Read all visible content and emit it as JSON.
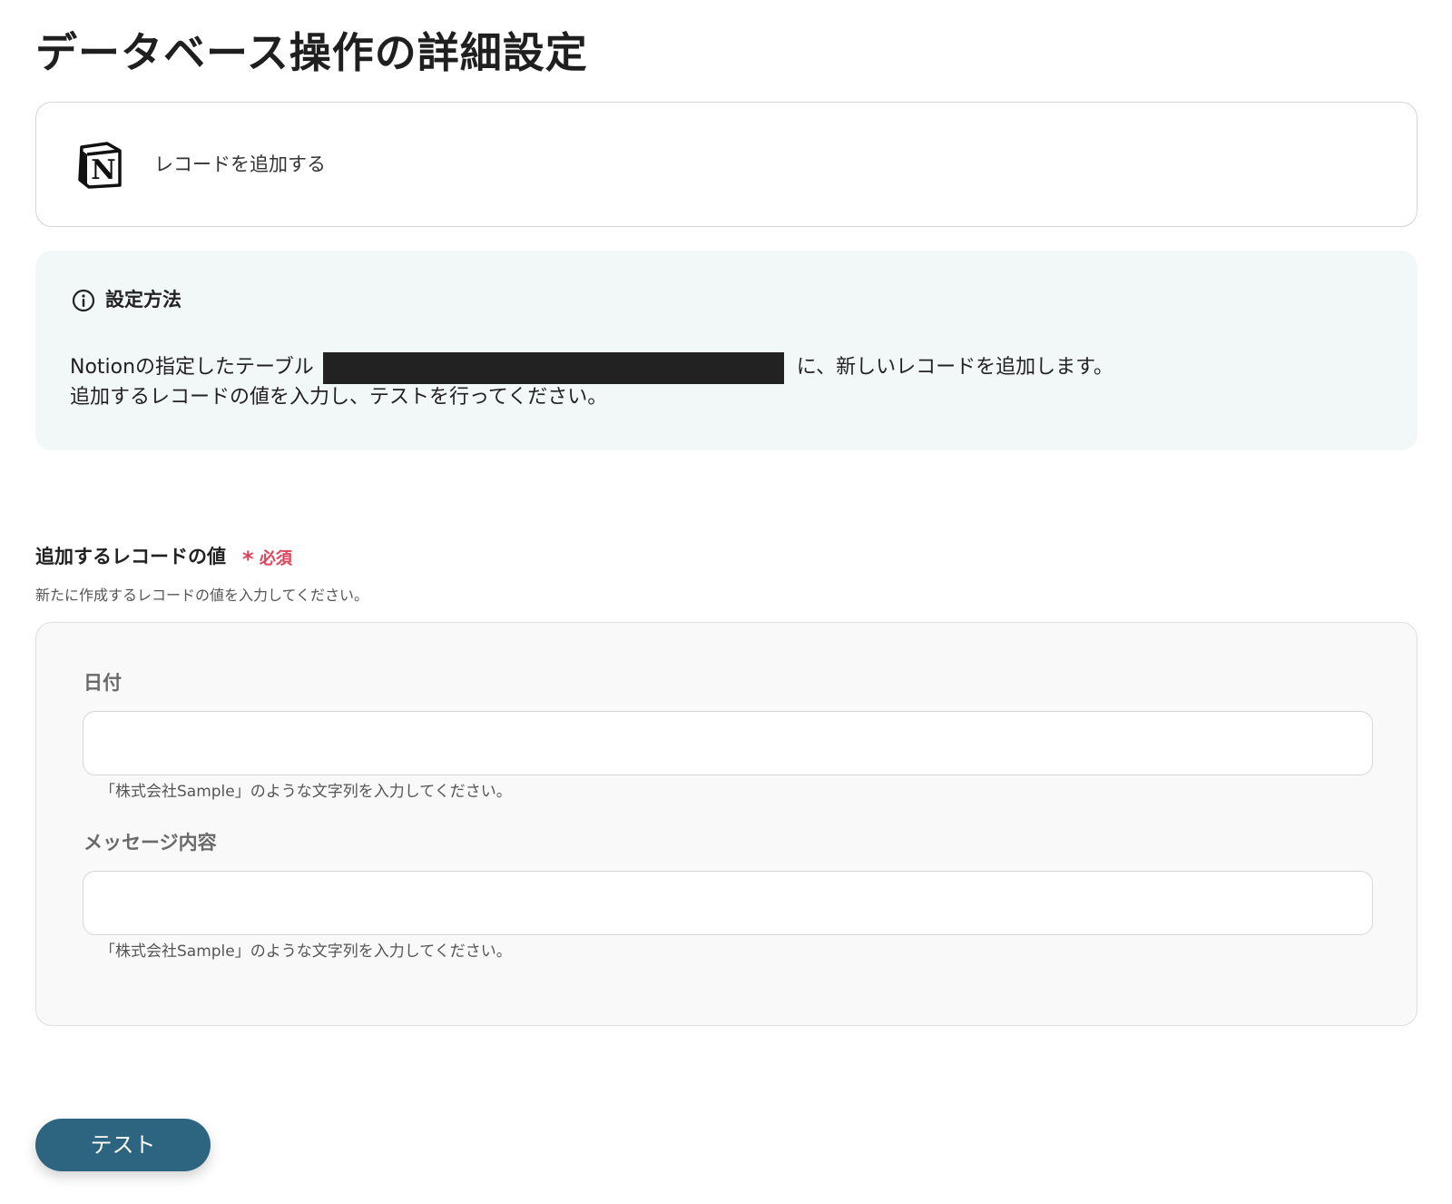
{
  "page": {
    "title": "データベース操作の詳細設定"
  },
  "action": {
    "app_icon": "notion-logo-icon",
    "label": "レコードを追加する"
  },
  "info": {
    "icon": "info-circle-icon",
    "title": "設定方法",
    "line1_prefix": "Notionの指定したテーブル",
    "line1_suffix": "に、新しいレコードを追加します。",
    "line2": "追加するレコードの値を入力し、テストを行ってください。"
  },
  "record_values": {
    "label": "追加するレコードの値",
    "required_mark": "*",
    "required_text": "必須",
    "help": "新たに作成するレコードの値を入力してください。",
    "fields": [
      {
        "label": "日付",
        "value": "",
        "hint": "「株式会社Sample」のような文字列を入力してください。"
      },
      {
        "label": "メッセージ内容",
        "value": "",
        "hint": "「株式会社Sample」のような文字列を入力してください。"
      }
    ]
  },
  "buttons": {
    "test_label": "テスト"
  },
  "colors": {
    "accent": "#2d6580",
    "required": "#e0445a",
    "info_bg": "#f2f8f8",
    "panel_bg": "#f9f9f9"
  }
}
